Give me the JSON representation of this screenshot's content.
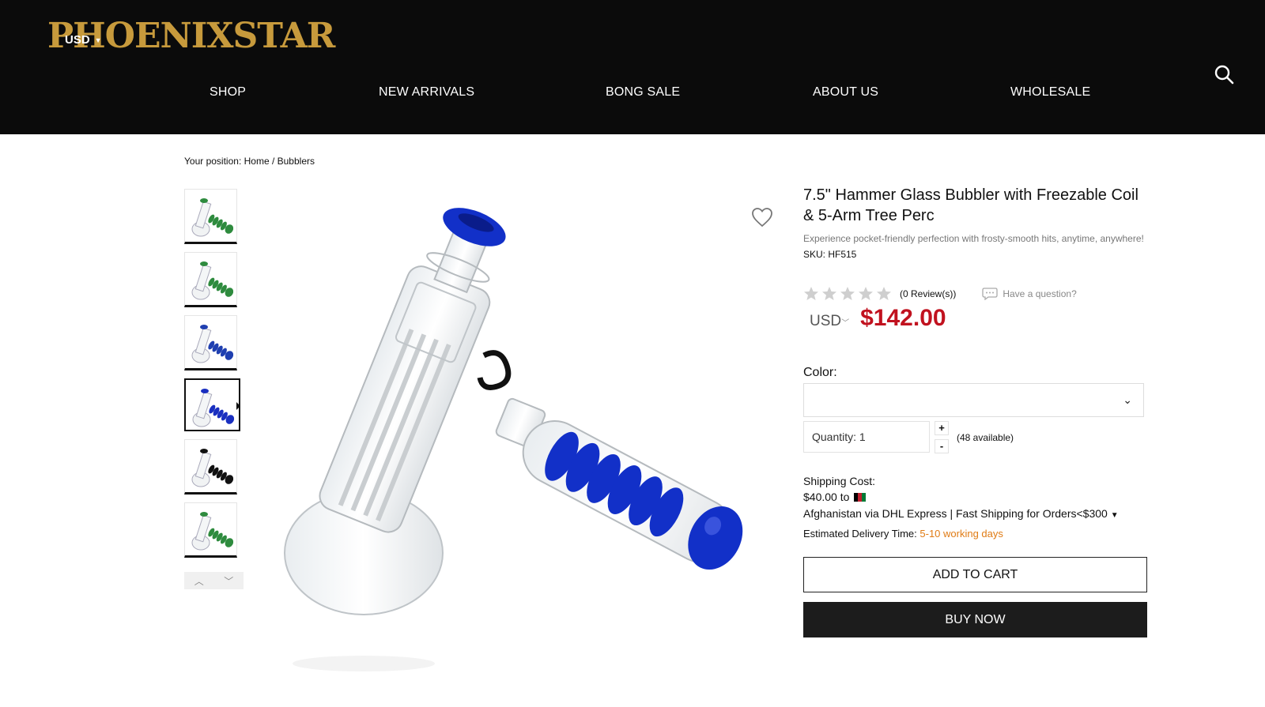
{
  "brand": {
    "logo_text": "PHOENIXSTAR"
  },
  "header": {
    "currency": "USD",
    "nav": [
      {
        "label": "SHOP"
      },
      {
        "label": "NEW ARRIVALS"
      },
      {
        "label": "BONG SALE"
      },
      {
        "label": "ABOUT US"
      },
      {
        "label": "WHOLESALE"
      }
    ]
  },
  "breadcrumb": {
    "text": "Your position: Home / Bubblers"
  },
  "product": {
    "title": "7.5\" Hammer Glass Bubbler with Freezable Coil & 5-Arm Tree Perc",
    "subtitle": "Experience pocket-friendly perfection with frosty-smooth hits, anytime, anywhere!",
    "sku": "SKU: HF515",
    "rating": 0,
    "reviews": "(0 Review(s))",
    "question": "Have a question?",
    "price_currency": "USD",
    "price": "$142.00",
    "color_label": "Color:",
    "color_value": "",
    "quantity": "Quantity: 1",
    "qty_plus": "+",
    "qty_minus": "-",
    "available": "(48 available)",
    "shipping_label": "Shipping Cost:",
    "shipping_cost": "$40.00 to",
    "shipping_method": "Afghanistan via DHL Express | Fast Shipping for Orders<$300",
    "delivery_label": "Estimated Delivery Time:",
    "delivery_days": "5-10 working days",
    "add_to_cart": "ADD TO CART",
    "buy_now": "BUY NOW"
  },
  "gallery": {
    "thumbnails": [
      {
        "coil_color": "#2e8b3e"
      },
      {
        "coil_color": "#2e8b3e"
      },
      {
        "coil_color": "#1f3fb0"
      },
      {
        "coil_color": "#1a2fc0",
        "active": true
      },
      {
        "coil_color": "#111111"
      },
      {
        "coil_color": "#2e8b3e"
      }
    ],
    "main_coil_color": "#1230c8"
  },
  "colors": {
    "header_bg": "#0b0b0b",
    "price": "#c1121f",
    "logo": "#c79a3c",
    "delivery_days": "#e07b14"
  }
}
